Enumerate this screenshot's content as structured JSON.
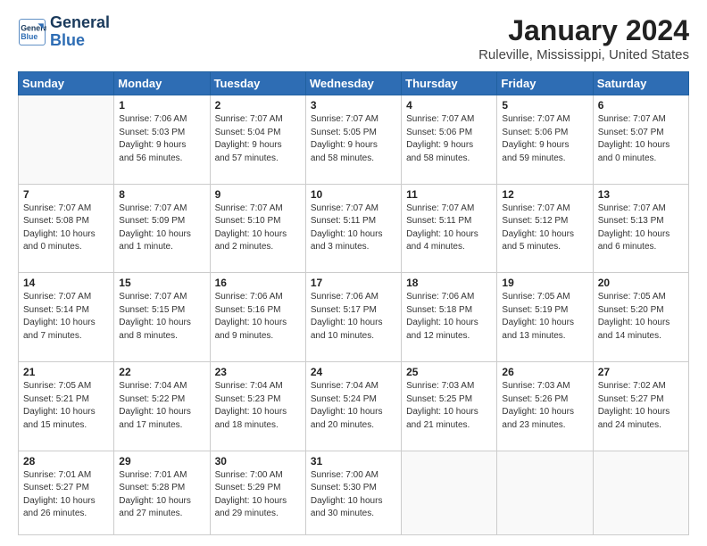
{
  "logo": {
    "line1": "General",
    "line2": "Blue"
  },
  "title": "January 2024",
  "location": "Ruleville, Mississippi, United States",
  "days_of_week": [
    "Sunday",
    "Monday",
    "Tuesday",
    "Wednesday",
    "Thursday",
    "Friday",
    "Saturday"
  ],
  "weeks": [
    [
      {
        "num": "",
        "info": ""
      },
      {
        "num": "1",
        "info": "Sunrise: 7:06 AM\nSunset: 5:03 PM\nDaylight: 9 hours\nand 56 minutes."
      },
      {
        "num": "2",
        "info": "Sunrise: 7:07 AM\nSunset: 5:04 PM\nDaylight: 9 hours\nand 57 minutes."
      },
      {
        "num": "3",
        "info": "Sunrise: 7:07 AM\nSunset: 5:05 PM\nDaylight: 9 hours\nand 58 minutes."
      },
      {
        "num": "4",
        "info": "Sunrise: 7:07 AM\nSunset: 5:06 PM\nDaylight: 9 hours\nand 58 minutes."
      },
      {
        "num": "5",
        "info": "Sunrise: 7:07 AM\nSunset: 5:06 PM\nDaylight: 9 hours\nand 59 minutes."
      },
      {
        "num": "6",
        "info": "Sunrise: 7:07 AM\nSunset: 5:07 PM\nDaylight: 10 hours\nand 0 minutes."
      }
    ],
    [
      {
        "num": "7",
        "info": "Sunrise: 7:07 AM\nSunset: 5:08 PM\nDaylight: 10 hours\nand 0 minutes."
      },
      {
        "num": "8",
        "info": "Sunrise: 7:07 AM\nSunset: 5:09 PM\nDaylight: 10 hours\nand 1 minute."
      },
      {
        "num": "9",
        "info": "Sunrise: 7:07 AM\nSunset: 5:10 PM\nDaylight: 10 hours\nand 2 minutes."
      },
      {
        "num": "10",
        "info": "Sunrise: 7:07 AM\nSunset: 5:11 PM\nDaylight: 10 hours\nand 3 minutes."
      },
      {
        "num": "11",
        "info": "Sunrise: 7:07 AM\nSunset: 5:11 PM\nDaylight: 10 hours\nand 4 minutes."
      },
      {
        "num": "12",
        "info": "Sunrise: 7:07 AM\nSunset: 5:12 PM\nDaylight: 10 hours\nand 5 minutes."
      },
      {
        "num": "13",
        "info": "Sunrise: 7:07 AM\nSunset: 5:13 PM\nDaylight: 10 hours\nand 6 minutes."
      }
    ],
    [
      {
        "num": "14",
        "info": "Sunrise: 7:07 AM\nSunset: 5:14 PM\nDaylight: 10 hours\nand 7 minutes."
      },
      {
        "num": "15",
        "info": "Sunrise: 7:07 AM\nSunset: 5:15 PM\nDaylight: 10 hours\nand 8 minutes."
      },
      {
        "num": "16",
        "info": "Sunrise: 7:06 AM\nSunset: 5:16 PM\nDaylight: 10 hours\nand 9 minutes."
      },
      {
        "num": "17",
        "info": "Sunrise: 7:06 AM\nSunset: 5:17 PM\nDaylight: 10 hours\nand 10 minutes."
      },
      {
        "num": "18",
        "info": "Sunrise: 7:06 AM\nSunset: 5:18 PM\nDaylight: 10 hours\nand 12 minutes."
      },
      {
        "num": "19",
        "info": "Sunrise: 7:05 AM\nSunset: 5:19 PM\nDaylight: 10 hours\nand 13 minutes."
      },
      {
        "num": "20",
        "info": "Sunrise: 7:05 AM\nSunset: 5:20 PM\nDaylight: 10 hours\nand 14 minutes."
      }
    ],
    [
      {
        "num": "21",
        "info": "Sunrise: 7:05 AM\nSunset: 5:21 PM\nDaylight: 10 hours\nand 15 minutes."
      },
      {
        "num": "22",
        "info": "Sunrise: 7:04 AM\nSunset: 5:22 PM\nDaylight: 10 hours\nand 17 minutes."
      },
      {
        "num": "23",
        "info": "Sunrise: 7:04 AM\nSunset: 5:23 PM\nDaylight: 10 hours\nand 18 minutes."
      },
      {
        "num": "24",
        "info": "Sunrise: 7:04 AM\nSunset: 5:24 PM\nDaylight: 10 hours\nand 20 minutes."
      },
      {
        "num": "25",
        "info": "Sunrise: 7:03 AM\nSunset: 5:25 PM\nDaylight: 10 hours\nand 21 minutes."
      },
      {
        "num": "26",
        "info": "Sunrise: 7:03 AM\nSunset: 5:26 PM\nDaylight: 10 hours\nand 23 minutes."
      },
      {
        "num": "27",
        "info": "Sunrise: 7:02 AM\nSunset: 5:27 PM\nDaylight: 10 hours\nand 24 minutes."
      }
    ],
    [
      {
        "num": "28",
        "info": "Sunrise: 7:01 AM\nSunset: 5:27 PM\nDaylight: 10 hours\nand 26 minutes."
      },
      {
        "num": "29",
        "info": "Sunrise: 7:01 AM\nSunset: 5:28 PM\nDaylight: 10 hours\nand 27 minutes."
      },
      {
        "num": "30",
        "info": "Sunrise: 7:00 AM\nSunset: 5:29 PM\nDaylight: 10 hours\nand 29 minutes."
      },
      {
        "num": "31",
        "info": "Sunrise: 7:00 AM\nSunset: 5:30 PM\nDaylight: 10 hours\nand 30 minutes."
      },
      {
        "num": "",
        "info": ""
      },
      {
        "num": "",
        "info": ""
      },
      {
        "num": "",
        "info": ""
      }
    ]
  ]
}
